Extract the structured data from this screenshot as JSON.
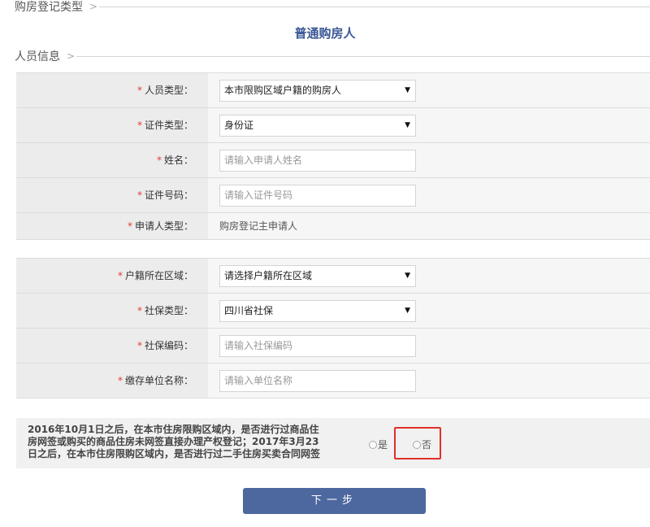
{
  "sections": {
    "purchase_type_title": "购房登记类型",
    "person_info_title": "人员信息"
  },
  "buyer_type": "普通购房人",
  "form1": {
    "person_type": {
      "label": "人员类型：",
      "value": "本市限购区域户籍的购房人"
    },
    "id_type": {
      "label": "证件类型：",
      "value": "身份证"
    },
    "name": {
      "label": "姓名：",
      "placeholder": "请输入申请人姓名"
    },
    "id_number": {
      "label": "证件号码：",
      "placeholder": "请输入证件号码"
    },
    "applicant_type": {
      "label": "申请人类型：",
      "value": "购房登记主申请人"
    }
  },
  "form2": {
    "household_area": {
      "label": "户籍所在区域：",
      "value": "请选择户籍所在区域"
    },
    "social_type": {
      "label": "社保类型：",
      "value": "四川省社保"
    },
    "social_number": {
      "label": "社保编码：",
      "placeholder": "请输入社保编码"
    },
    "employer": {
      "label": "缴存单位名称：",
      "placeholder": "请输入单位名称"
    }
  },
  "question": {
    "text": "2016年10月1日之后，在本市住房限购区域内，是否进行过商品住房网签或购买的商品住房未网签直接办理产权登记；2017年3月23日之后，在本市住房限购区域内，是否进行过二手住房买卖合同网签",
    "yes_label": "是",
    "no_label": "否"
  },
  "next_button": "下一步",
  "colors": {
    "accent": "#3a5795",
    "button": "#4d679f",
    "required": "#e03c31",
    "highlight": "#e0302a"
  },
  "icons": {
    "section_chevron": "chevron-right-icon",
    "select_arrow": "caret-down-icon"
  }
}
